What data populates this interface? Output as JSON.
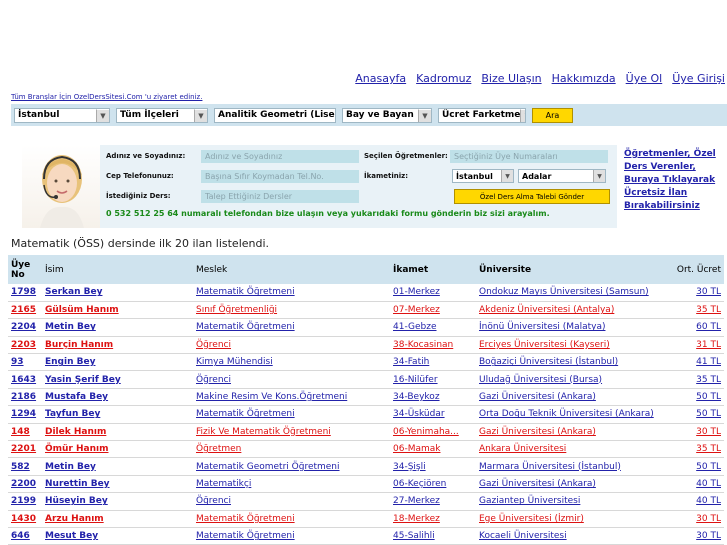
{
  "nav": [
    "Anasayfa",
    "Kadromuz",
    "Bize Ulaşın",
    "Hakkımızda",
    "Üye Ol",
    "Üye Girişi"
  ],
  "all_branches_link": "Tüm Branşlar İçin OzelDersSitesi.Com 'u ziyaret ediniz.",
  "filters": {
    "city": "İstanbul",
    "district": "Tüm İlçeleri",
    "subject": "Analitik Geometri (Lise",
    "gender": "Bay ve Bayan",
    "fee": "Ücret Farketme",
    "search_button": "Ara"
  },
  "form": {
    "name_label": "Adınız ve Soyadınız:",
    "name_placeholder": "Adınız ve Soyadınız",
    "phone_label": "Cep Telefonunuz:",
    "phone_placeholder": "Başına Sıfır Koymadan Tel.No.",
    "lesson_label": "İstediğiniz Ders:",
    "lesson_placeholder": "Talep Ettiğiniz Dersler",
    "selected_label": "Seçilen Öğretmenler:",
    "selected_placeholder": "Seçtiğiniz Üye Numaraları",
    "residence_label": "İkametiniz:",
    "residence_city": "İstanbul",
    "residence_district": "Adalar",
    "send_button": "Özel Ders Alma Talebi Gönder",
    "phone_note": "0 532 512 25 64 numaralı telefondan bize ulaşın veya yukarıdaki formu gönderin biz sizi arayalım."
  },
  "teacher_link": "Öğretmenler, Özel Ders Verenler, Buraya Tıklayarak Ücretsiz İlan Bırakabilirsiniz",
  "summary": "Matematik (ÖSS) dersinde ilk 20 ilan listelendi.",
  "table": {
    "headers": {
      "no": "Üye No",
      "name": "İsim",
      "job": "Meslek",
      "city": "İkamet",
      "uni": "Üniversite",
      "fee": "Ort. Ücret"
    },
    "rows": [
      {
        "no": "1798",
        "name": "Serkan Bey",
        "job": "Matematik Öğretmeni",
        "city": "01-Merkez",
        "uni": "Ondokuz Mayıs Üniversitesi (Samsun)",
        "fee": "30 TL",
        "gender": "m"
      },
      {
        "no": "2165",
        "name": "Gülsüm Hanım",
        "job": "Sınıf Öğretmenliği",
        "city": "07-Merkez",
        "uni": "Akdeniz Üniversitesi (Antalya)",
        "fee": "35 TL",
        "gender": "f"
      },
      {
        "no": "2204",
        "name": "Metin Bey",
        "job": "Matematik Öğretmeni",
        "city": "41-Gebze",
        "uni": "İnönü Üniversitesi (Malatya)",
        "fee": "60 TL",
        "gender": "m"
      },
      {
        "no": "2203",
        "name": "Burçin Hanım",
        "job": "Öğrenci",
        "city": "38-Kocasinan",
        "uni": "Erciyes Üniversitesi (Kayseri)",
        "fee": "31 TL",
        "gender": "f"
      },
      {
        "no": "93",
        "name": "Engin Bey",
        "job": "Kimya Mühendisi",
        "city": "34-Fatih",
        "uni": "Boğaziçi Üniversitesi (İstanbul)",
        "fee": "41 TL",
        "gender": "m"
      },
      {
        "no": "1643",
        "name": "Yasin Şerif Bey",
        "job": "Öğrenci",
        "city": "16-Nilüfer",
        "uni": "Uludağ Üniversitesi (Bursa)",
        "fee": "35 TL",
        "gender": "m"
      },
      {
        "no": "2186",
        "name": "Mustafa Bey",
        "job": "Makine Resim Ve Kons.Öğretmeni",
        "city": "34-Beykoz",
        "uni": "Gazi Üniversitesi (Ankara)",
        "fee": "50 TL",
        "gender": "m"
      },
      {
        "no": "1294",
        "name": "Tayfun Bey",
        "job": "Matematik Öğretmeni",
        "city": "34-Üsküdar",
        "uni": "Orta Doğu Teknik Üniversitesi (Ankara)",
        "fee": "50 TL",
        "gender": "m"
      },
      {
        "no": "148",
        "name": "Dilek Hanım",
        "job": "Fizik Ve Matematik Öğretmeni",
        "city": "06-Yenimaha...",
        "uni": "Gazi Üniversitesi (Ankara)",
        "fee": "30 TL",
        "gender": "f"
      },
      {
        "no": "2201",
        "name": "Ömür Hanım",
        "job": "Öğretmen",
        "city": "06-Mamak",
        "uni": "Ankara Üniversitesi",
        "fee": "35 TL",
        "gender": "f"
      },
      {
        "no": "582",
        "name": "Metin Bey",
        "job": "Matematik Geometri Öğretmeni",
        "city": "34-Şişli",
        "uni": "Marmara Üniversitesi (İstanbul)",
        "fee": "50 TL",
        "gender": "m"
      },
      {
        "no": "2200",
        "name": "Nurettin Bey",
        "job": "Matematikçi",
        "city": "06-Keçiören",
        "uni": "Gazi Üniversitesi (Ankara)",
        "fee": "40 TL",
        "gender": "m"
      },
      {
        "no": "2199",
        "name": "Hüseyin Bey",
        "job": "Öğrenci",
        "city": "27-Merkez",
        "uni": "Gaziantep Üniversitesi",
        "fee": "40 TL",
        "gender": "m"
      },
      {
        "no": "1430",
        "name": "Arzu Hanım",
        "job": "Matematik Öğretmeni",
        "city": "18-Merkez",
        "uni": "Ege Üniversitesi (İzmir)",
        "fee": "30 TL",
        "gender": "f"
      },
      {
        "no": "646",
        "name": "Mesut Bey",
        "job": "Matematik Öğretmeni",
        "city": "45-Salihli",
        "uni": "Kocaeli Üniversitesi",
        "fee": "30 TL",
        "gender": "m"
      }
    ]
  },
  "colors": {
    "male_link": "#2222aa",
    "female_link": "#dd1111",
    "header_bg": "#cfe3ee",
    "button": "#ffd700",
    "phone_note": "#1a8a1a"
  }
}
